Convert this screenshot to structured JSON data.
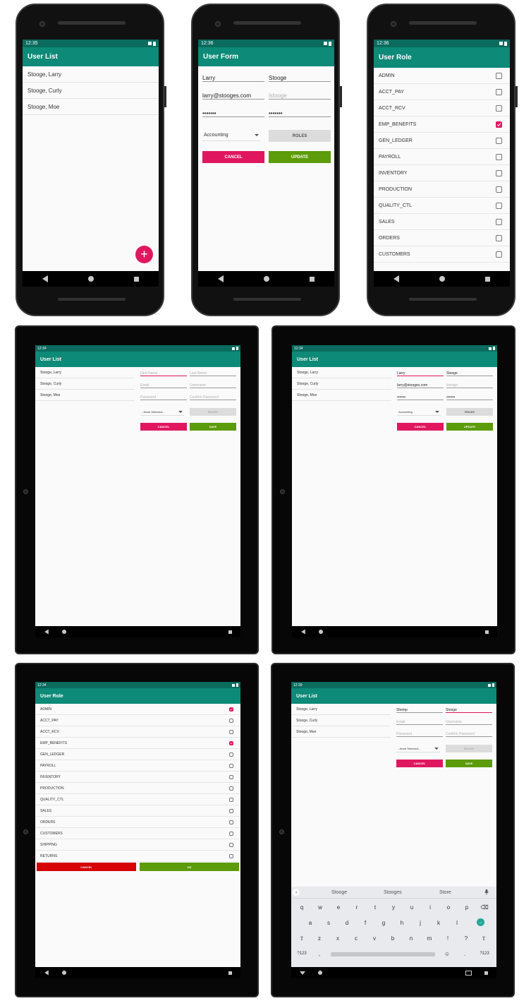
{
  "colors": {
    "primary": "#0d8a78",
    "primary_dark": "#0a6b5e",
    "accent": "#e0175f",
    "green": "#5c9b0a",
    "red": "#d50000"
  },
  "phone1": {
    "time": "12:35",
    "title": "User List",
    "users": [
      "Stooge, Larry",
      "Stooge, Curly",
      "Stooge, Moe"
    ],
    "fab_icon": "+"
  },
  "phone2": {
    "time": "12:36",
    "title": "User Form",
    "first_name": "Larry",
    "last_name": "Stooge",
    "email": "larry@stooges.com",
    "username_placeholder": "lstooge",
    "password": "•••••••",
    "confirm": "•••••••",
    "department": "Accounting",
    "roles_label": "ROLES",
    "cancel_label": "CANCEL",
    "update_label": "UPDATE"
  },
  "phone3": {
    "time": "12:36",
    "title": "User Role",
    "roles": [
      {
        "name": "ADMIN",
        "checked": false
      },
      {
        "name": "ACCT_PAY",
        "checked": false
      },
      {
        "name": "ACCT_RCV",
        "checked": false
      },
      {
        "name": "EMP_BENEFITS",
        "checked": true
      },
      {
        "name": "GEN_LEDGER",
        "checked": false
      },
      {
        "name": "PAYROLL",
        "checked": false
      },
      {
        "name": "INVENTORY",
        "checked": false
      },
      {
        "name": "PRODUCTION",
        "checked": false
      },
      {
        "name": "QUALITY_CTL",
        "checked": false
      },
      {
        "name": "SALES",
        "checked": false
      },
      {
        "name": "ORDERS",
        "checked": false
      },
      {
        "name": "CUSTOMERS",
        "checked": false
      }
    ]
  },
  "tablet1": {
    "time": "12:34",
    "title": "User List",
    "users": [
      "Stooge, Larry",
      "Stooge, Curly",
      "Stooge, Moe"
    ],
    "first_name_ph": "First Name",
    "last_name_ph": "Last Name",
    "email_ph": "Email",
    "username_ph": "Username",
    "password_ph": "Password",
    "confirm_ph": "Confirm Password",
    "department": "--None Selected--",
    "roles_label": "ROLES",
    "cancel_label": "CANCEL",
    "save_label": "SAVE"
  },
  "tablet2": {
    "time": "12:34",
    "title": "User List",
    "users": [
      "Stooge, Larry",
      "Stooge, Curly",
      "Stooge, Moe"
    ],
    "first_name": "Larry",
    "last_name": "Stooge",
    "email": "larry@stooges.com",
    "username_ph": "lstooge",
    "password": "•••••••",
    "confirm": "•••••••",
    "department": "Accounting",
    "roles_label": "ROLES",
    "cancel_label": "CANCEL",
    "update_label": "UPDATE"
  },
  "tablet3": {
    "time": "12:34",
    "title": "User Role",
    "roles": [
      {
        "name": "ADMIN",
        "checked": true
      },
      {
        "name": "ACCT_PAY",
        "checked": false
      },
      {
        "name": "ACCT_RCV",
        "checked": false
      },
      {
        "name": "EMP_BENEFITS",
        "checked": true
      },
      {
        "name": "GEN_LEDGER",
        "checked": false
      },
      {
        "name": "PAYROLL",
        "checked": false
      },
      {
        "name": "INVENTORY",
        "checked": false
      },
      {
        "name": "PRODUCTION",
        "checked": false
      },
      {
        "name": "QUALITY_CTL",
        "checked": false
      },
      {
        "name": "SALES",
        "checked": false
      },
      {
        "name": "ORDERS",
        "checked": false
      },
      {
        "name": "CUSTOMERS",
        "checked": false
      },
      {
        "name": "SHIPPING",
        "checked": false
      },
      {
        "name": "RETURNS",
        "checked": false
      }
    ],
    "cancel_label": "CANCEL",
    "ok_label": "OK"
  },
  "tablet4": {
    "time": "12:39",
    "title": "User List",
    "users": [
      "Stooge, Larry",
      "Stooge, Curly",
      "Stooge, Moe"
    ],
    "first_name": "Shemp",
    "last_name": "Stooge",
    "email_ph": "Email",
    "username_ph": "Username",
    "password_ph": "Password",
    "confirm_ph": "Confirm Password",
    "department": "--None Selected--",
    "roles_label": "ROLES",
    "cancel_label": "CANCEL",
    "save_label": "SAVE",
    "suggestions": [
      "Stooge",
      "Stooges",
      "Store"
    ],
    "row1": [
      "q",
      "w",
      "e",
      "r",
      "t",
      "y",
      "u",
      "i",
      "o",
      "p"
    ],
    "row2": [
      "a",
      "s",
      "d",
      "f",
      "g",
      "h",
      "j",
      "k",
      "l"
    ],
    "row3": [
      "z",
      "x",
      "c",
      "v",
      "b",
      "n",
      "m",
      "!",
      "?"
    ],
    "sym_label": "?123",
    "comma": ",",
    "period": ".",
    "shift_icon": "⇧",
    "backspace_icon": "⌫",
    "enter_icon": "→",
    "emoji_icon": "☺",
    "mic_icon": "🎤",
    "expand_icon": "›"
  }
}
